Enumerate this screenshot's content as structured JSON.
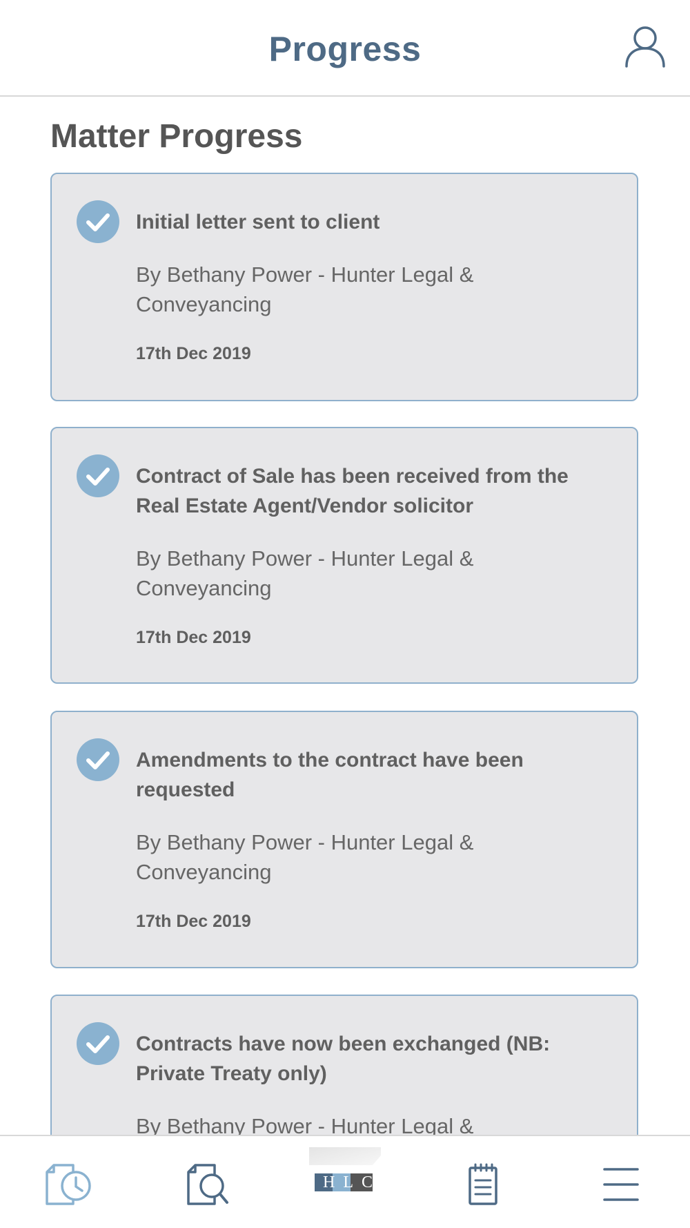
{
  "header": {
    "title": "Progress",
    "profile_icon": "user-profile-icon"
  },
  "section": {
    "title": "Matter Progress"
  },
  "progress_items": [
    {
      "title": "Initial letter sent to client",
      "author": "By Bethany Power - Hunter Legal & Conveyancing",
      "date": "17th Dec 2019",
      "status_icon": "check-circle-icon"
    },
    {
      "title": "Contract of Sale has been received from the Real Estate Agent/Vendor solicitor",
      "author": "By Bethany Power - Hunter Legal & Conveyancing",
      "date": "17th Dec 2019",
      "status_icon": "check-circle-icon"
    },
    {
      "title": "Amendments to the contract have been requested",
      "author": "By Bethany Power - Hunter Legal & Conveyancing",
      "date": "17th Dec 2019",
      "status_icon": "check-circle-icon"
    },
    {
      "title": "Contracts have now been exchanged (NB: Private Treaty only)",
      "author": "By Bethany Power - Hunter Legal & Conveyancing",
      "date": "",
      "status_icon": "check-circle-icon"
    }
  ],
  "bottom_nav": {
    "items": [
      {
        "icon": "document-clock-icon"
      },
      {
        "icon": "document-search-icon"
      },
      {
        "icon": "hlc-logo",
        "logo_text": "HLC"
      },
      {
        "icon": "notepad-icon"
      },
      {
        "icon": "hamburger-menu-icon"
      }
    ]
  },
  "colors": {
    "accent": "#4e6a85",
    "check": "#8ab2d0",
    "card_bg": "#e7e7e9",
    "card_border": "#8fb0cc"
  }
}
